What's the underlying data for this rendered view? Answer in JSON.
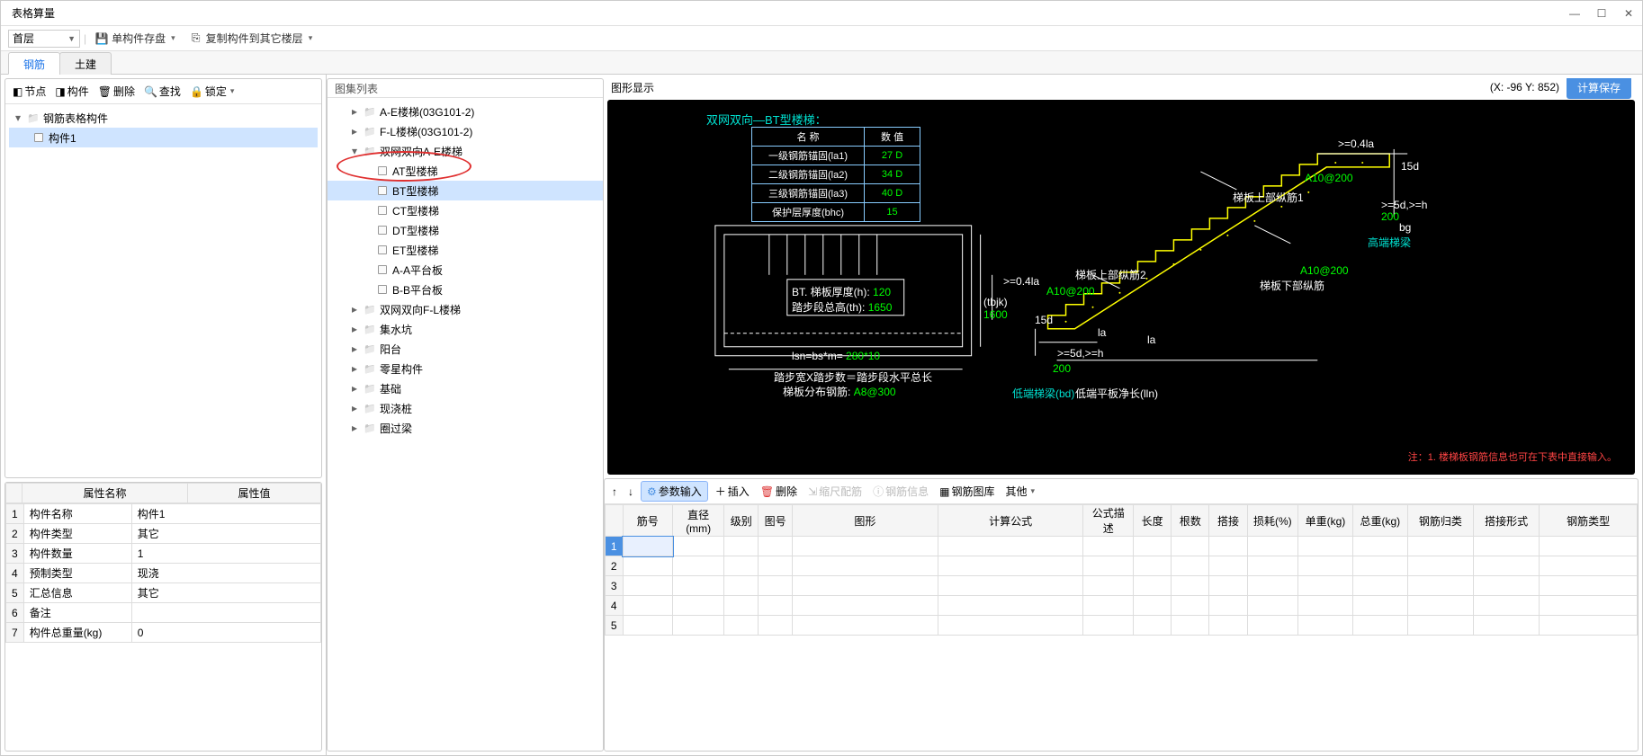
{
  "window": {
    "title": "表格算量"
  },
  "toolbar": {
    "floor": "首层",
    "save_component": "单构件存盘",
    "copy_component": "复制构件到其它楼层"
  },
  "tabs": {
    "rebar": "钢筋",
    "civil": "土建"
  },
  "left_toolbar": {
    "node": "节点",
    "component": "构件",
    "delete": "删除",
    "find": "查找",
    "lock": "锁定"
  },
  "left_tree": {
    "root": "钢筋表格构件",
    "child": "构件1"
  },
  "props": {
    "header_name": "属性名称",
    "header_value": "属性值",
    "rows": [
      {
        "n": "构件名称",
        "v": "构件1"
      },
      {
        "n": "构件类型",
        "v": "其它"
      },
      {
        "n": "构件数量",
        "v": "1"
      },
      {
        "n": "预制类型",
        "v": "现浇"
      },
      {
        "n": "汇总信息",
        "v": "其它"
      },
      {
        "n": "备注",
        "v": ""
      },
      {
        "n": "构件总重量(kg)",
        "v": "0"
      }
    ]
  },
  "center": {
    "title": "图集列表",
    "items": [
      {
        "lvl": 1,
        "toggle": "▸",
        "icon": "folder",
        "label": "A-E楼梯(03G101-2)"
      },
      {
        "lvl": 1,
        "toggle": "▸",
        "icon": "folder",
        "label": "F-L楼梯(03G101-2)"
      },
      {
        "lvl": 1,
        "toggle": "▾",
        "icon": "folder",
        "label": "双网双向A-E楼梯"
      },
      {
        "lvl": 2,
        "toggle": "",
        "icon": "square",
        "label": "AT型楼梯"
      },
      {
        "lvl": 2,
        "toggle": "",
        "icon": "square",
        "label": "BT型楼梯",
        "selected": true
      },
      {
        "lvl": 2,
        "toggle": "",
        "icon": "square",
        "label": "CT型楼梯"
      },
      {
        "lvl": 2,
        "toggle": "",
        "icon": "square",
        "label": "DT型楼梯"
      },
      {
        "lvl": 2,
        "toggle": "",
        "icon": "square",
        "label": "ET型楼梯"
      },
      {
        "lvl": 2,
        "toggle": "",
        "icon": "square",
        "label": "A-A平台板"
      },
      {
        "lvl": 2,
        "toggle": "",
        "icon": "square",
        "label": "B-B平台板"
      },
      {
        "lvl": 1,
        "toggle": "▸",
        "icon": "folder",
        "label": "双网双向F-L楼梯"
      },
      {
        "lvl": 1,
        "toggle": "▸",
        "icon": "folder",
        "label": "集水坑"
      },
      {
        "lvl": 1,
        "toggle": "▸",
        "icon": "folder",
        "label": "阳台"
      },
      {
        "lvl": 1,
        "toggle": "▸",
        "icon": "folder",
        "label": "零星构件"
      },
      {
        "lvl": 1,
        "toggle": "▸",
        "icon": "folder",
        "label": "基础"
      },
      {
        "lvl": 1,
        "toggle": "▸",
        "icon": "folder",
        "label": "现浇桩"
      },
      {
        "lvl": 1,
        "toggle": "▸",
        "icon": "folder",
        "label": "圈过梁"
      }
    ]
  },
  "graphic": {
    "title": "图形显示",
    "coords": "(X: -96 Y: 852)",
    "calc_save": "计算保存",
    "cad_title": "双网双向—BT型楼梯：",
    "cad_table": {
      "hdr_name": "名 称",
      "hdr_val": "数 值",
      "rows": [
        {
          "n": "一级钢筋锚固(la1)",
          "v": "27 D"
        },
        {
          "n": "二级钢筋锚固(la2)",
          "v": "34 D"
        },
        {
          "n": "三级钢筋锚固(la3)",
          "v": "40 D"
        },
        {
          "n": "保护层厚度(bhc)",
          "v": "15"
        }
      ]
    },
    "labels": {
      "bt_h": "BT. 梯板厚度(h):",
      "bt_h_v": "120",
      "th": "踏步段总高(th):",
      "th_v": "1650",
      "lsn": "lsn=bs*m=",
      "lsn_v": "280*10",
      "caption1": "踏步宽X踏步数＝踏步段水平总长",
      "caption2": "梯板分布钢筋:",
      "caption2_v": "A8@300",
      "tbjk": "(tbjk)",
      "tbjk_v": "1600",
      "la04": ">=0.4la",
      "la04b": ">=0.4la",
      "d5h": ">=5d,>=h",
      "d5h_b": ">=5d,>=h",
      "bg": "bg",
      "num200a": "200",
      "num200b": "200",
      "num200c": "200",
      "a10a": "A10@200",
      "a10b": "A10@200",
      "a10c": "A10@200",
      "top1": "梯板上部纵筋1",
      "top2": "梯板上部纵筋2",
      "bottom": "梯板下部纵筋",
      "high_beam": "高端梯梁",
      "low_beam": "低端梯梁(bd)",
      "low_plate": "低端平板净长(lln)",
      "fifteen_d": "15d",
      "fifteen_d2": "15d",
      "la": "la",
      "la2": "la"
    },
    "note": "注：1. 楼梯板钢筋信息也可在下表中直接输入。"
  },
  "bottom_toolbar": {
    "param_input": "参数输入",
    "insert": "插入",
    "delete": "删除",
    "scale": "缩尺配筋",
    "info": "钢筋信息",
    "library": "钢筋图库",
    "other": "其他"
  },
  "grid": {
    "cols": [
      "筋号",
      "直径(mm)",
      "级别",
      "图号",
      "图形",
      "计算公式",
      "公式描述",
      "长度",
      "根数",
      "搭接",
      "损耗(%)",
      "单重(kg)",
      "总重(kg)",
      "钢筋归类",
      "搭接形式",
      "钢筋类型"
    ],
    "rows": 5
  }
}
